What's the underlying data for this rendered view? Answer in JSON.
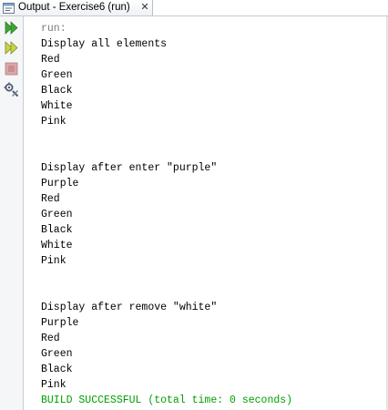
{
  "tab": {
    "title": "Output - Exercise6 (run)",
    "close_glyph": "✕"
  },
  "toolbar": {
    "buttons": [
      {
        "icon": "rerun-icon"
      },
      {
        "icon": "rerun-with-options-icon"
      },
      {
        "icon": "stop-icon"
      },
      {
        "icon": "settings-icon"
      }
    ]
  },
  "output": {
    "lines": [
      {
        "text": "run:",
        "type": "run"
      },
      {
        "text": "Display all elements",
        "type": "normal"
      },
      {
        "text": "Red",
        "type": "normal"
      },
      {
        "text": "Green",
        "type": "normal"
      },
      {
        "text": "Black",
        "type": "normal"
      },
      {
        "text": "White",
        "type": "normal"
      },
      {
        "text": "Pink",
        "type": "normal"
      },
      {
        "text": "",
        "type": "normal"
      },
      {
        "text": "",
        "type": "normal"
      },
      {
        "text": "Display after enter \"purple\"",
        "type": "normal"
      },
      {
        "text": "Purple",
        "type": "normal"
      },
      {
        "text": "Red",
        "type": "normal"
      },
      {
        "text": "Green",
        "type": "normal"
      },
      {
        "text": "Black",
        "type": "normal"
      },
      {
        "text": "White",
        "type": "normal"
      },
      {
        "text": "Pink",
        "type": "normal"
      },
      {
        "text": "",
        "type": "normal"
      },
      {
        "text": "",
        "type": "normal"
      },
      {
        "text": "Display after remove \"white\"",
        "type": "normal"
      },
      {
        "text": "Purple",
        "type": "normal"
      },
      {
        "text": "Red",
        "type": "normal"
      },
      {
        "text": "Green",
        "type": "normal"
      },
      {
        "text": "Black",
        "type": "normal"
      },
      {
        "text": "Pink",
        "type": "normal"
      },
      {
        "text": "BUILD SUCCESSFUL (total time: 0 seconds)",
        "type": "success"
      }
    ]
  },
  "colors": {
    "run_text": "#7b7b7b",
    "success_text": "#00a000",
    "rerun_green": "#3fa535"
  }
}
